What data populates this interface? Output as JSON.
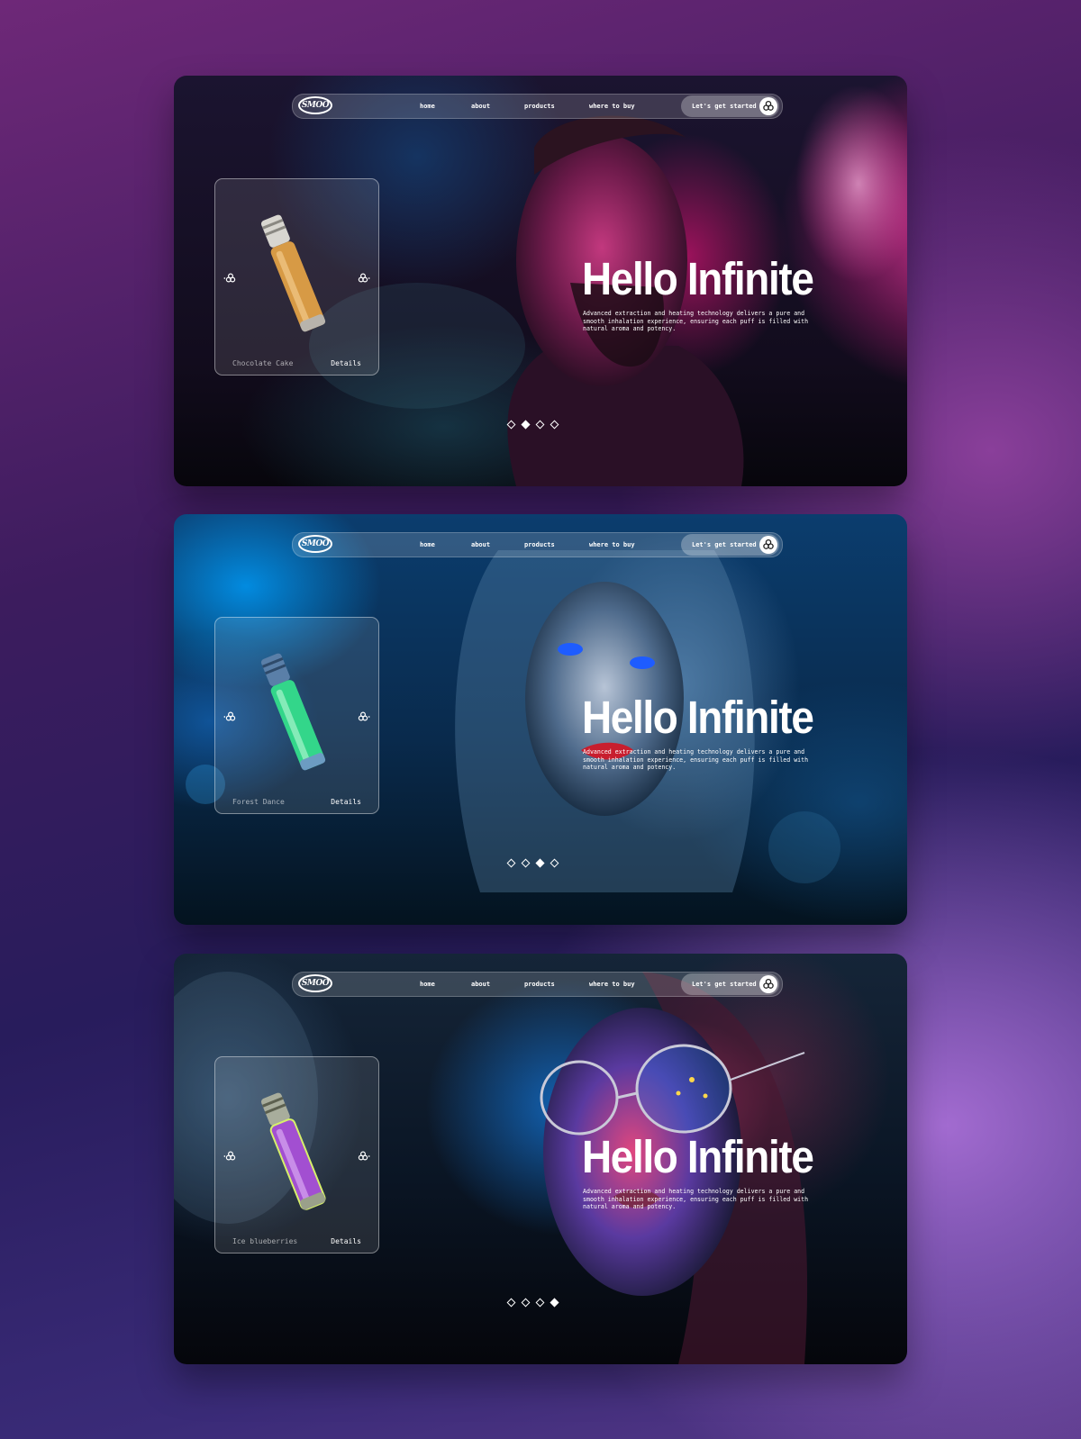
{
  "colors": {
    "page_background": "#3a1c62",
    "screen_1_accent": "#ff2d9a",
    "screen_2_accent": "#0aa6ff",
    "screen_3_accent": "#e8408f",
    "bottle_1": "#d79a45",
    "bottle_2": "#33d68a",
    "bottle_3": "#a24fd1"
  },
  "icons": {
    "logo": "smoo-oval-logo",
    "cta": "triskelion-icon",
    "prev": "triskelion-left-icon",
    "next": "triskelion-right-icon",
    "pager": "diamond-dot-icon"
  },
  "screens": [
    {
      "nav": {
        "logo": "SMOO",
        "home": "home",
        "about": "about",
        "products": "products",
        "where_to_buy": "where to buy",
        "cta": "Let's get started"
      },
      "product": {
        "flavor": "Chocolate Cake",
        "details": "Details",
        "color": "#d79a45"
      },
      "hero": {
        "title": "Hello Infinite",
        "description": "Advanced extraction and heating technology delivers a pure and smooth inhalation experience, ensuring each puff is filled with natural aroma and potency."
      },
      "pager": {
        "count": 4,
        "active_index": 2
      }
    },
    {
      "nav": {
        "logo": "SMOO",
        "home": "home",
        "about": "about",
        "products": "products",
        "where_to_buy": "where to buy",
        "cta": "Let's get started"
      },
      "product": {
        "flavor": "Forest Dance",
        "details": "Details",
        "color": "#33d68a"
      },
      "hero": {
        "title": "Hello Infinite",
        "description": "Advanced extraction and heating technology delivers a pure and smooth inhalation experience, ensuring each puff is filled with natural aroma and potency."
      },
      "pager": {
        "count": 4,
        "active_index": 3
      }
    },
    {
      "nav": {
        "logo": "SMOO",
        "home": "home",
        "about": "about",
        "products": "products",
        "where_to_buy": "where to buy",
        "cta": "Let's get started"
      },
      "product": {
        "flavor": "Ice blueberries",
        "details": "Details",
        "color": "#a24fd1"
      },
      "hero": {
        "title": "Hello Infinite",
        "description": "Advanced extraction and heating technology delivers a pure and smooth inhalation experience, ensuring each puff is filled with natural aroma and potency."
      },
      "pager": {
        "count": 4,
        "active_index": 4
      }
    }
  ]
}
